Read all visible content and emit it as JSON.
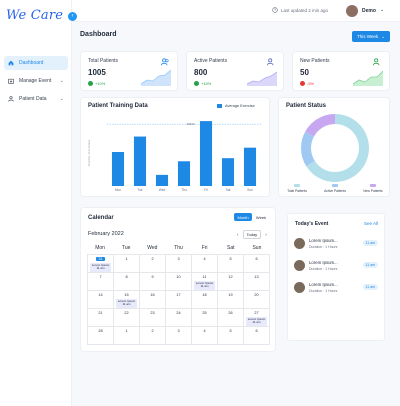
{
  "brand": {
    "name": "We Care"
  },
  "sidebar": {
    "items": [
      {
        "label": "Dashboard",
        "icon": "home-icon",
        "active": true
      },
      {
        "label": "Manage Event",
        "icon": "calendar-plus-icon",
        "active": false
      },
      {
        "label": "Patient Data",
        "icon": "user-icon",
        "active": false
      }
    ]
  },
  "topbar": {
    "last_updated": "Last updated 2 min ago",
    "user_name": "Demo"
  },
  "dashboard": {
    "title": "Dashboard",
    "range_label": "This Week"
  },
  "stats": [
    {
      "label": "Total Patients",
      "value": "1005",
      "change": "+10%",
      "color": "#22a447"
    },
    {
      "label": "Active Patients",
      "value": "800",
      "change": "+15%",
      "color": "#22a447"
    },
    {
      "label": "New Patients",
      "value": "50",
      "change": "-5%",
      "color": "#e53935"
    }
  ],
  "training": {
    "title": "Patient Training Data",
    "legend": "Average Exercise",
    "chart_data": {
      "type": "bar",
      "categories": [
        "Mon",
        "Tue",
        "Wed",
        "Thu",
        "Fri",
        "Sat",
        "Sun"
      ],
      "values": [
        55,
        80,
        18,
        40,
        105,
        45,
        62
      ],
      "ylim": [
        0,
        110
      ],
      "average": 100,
      "average_label": "10000",
      "ylabel": "Number of Activities",
      "color": "#1e88e5"
    }
  },
  "status": {
    "title": "Patient Status",
    "chart_data": {
      "type": "pie",
      "labels": [
        "Total Patients",
        "Active Patients",
        "New Patients"
      ],
      "values": [
        66,
        17,
        17
      ],
      "colors": [
        "#b2dfea",
        "#9fc9f2",
        "#c7a8f0"
      ]
    }
  },
  "calendar": {
    "title": "Calendar",
    "tabs": [
      "Month",
      "Week"
    ],
    "month_label": "February 2022",
    "today_label": "Today",
    "weekdays": [
      "Mon",
      "Tue",
      "Wed",
      "Thu",
      "Fri",
      "Sat",
      "Sun"
    ],
    "weeks": [
      [
        {
          "d": "",
          "sel": false
        },
        {
          "d": "1"
        },
        {
          "d": "2"
        },
        {
          "d": "3"
        },
        {
          "d": "4"
        },
        {
          "d": "5"
        },
        {
          "d": "6"
        }
      ],
      [
        {
          "d": "7"
        },
        {
          "d": "8"
        },
        {
          "d": "9"
        },
        {
          "d": "10"
        },
        {
          "d": "11"
        },
        {
          "d": "12"
        },
        {
          "d": "13"
        }
      ],
      [
        {
          "d": "14"
        },
        {
          "d": "15"
        },
        {
          "d": "16"
        },
        {
          "d": "17"
        },
        {
          "d": "18"
        },
        {
          "d": "19"
        },
        {
          "d": "20"
        }
      ],
      [
        {
          "d": "21"
        },
        {
          "d": "22"
        },
        {
          "d": "23"
        },
        {
          "d": "24"
        },
        {
          "d": "25"
        },
        {
          "d": "26"
        },
        {
          "d": "27"
        }
      ],
      [
        {
          "d": "28"
        },
        {
          "d": "1"
        },
        {
          "d": "2"
        },
        {
          "d": "3"
        },
        {
          "d": "4"
        },
        {
          "d": "5"
        },
        {
          "d": "6"
        }
      ]
    ],
    "selected_label": "31",
    "events": [
      {
        "week": 0,
        "day": 0,
        "title": "Lorem Ipsum",
        "sub": "11 am"
      },
      {
        "week": 1,
        "day": 4,
        "title": "Lorem Ipsum",
        "sub": "11 am"
      },
      {
        "week": 2,
        "day": 1,
        "title": "Lorem Ipsum",
        "sub": "11 am"
      },
      {
        "week": 3,
        "day": 6,
        "title": "Lorem Ipsum",
        "sub": "11 am"
      }
    ]
  },
  "today_events": {
    "title": "Today's Event",
    "see_all": "See All",
    "items": [
      {
        "name": "Lorem Ipsum...",
        "duration": "Duration : 1 Hours",
        "time": "11 am"
      },
      {
        "name": "Lorem Ipsum...",
        "duration": "Duration : 1 Hours",
        "time": "11 am"
      },
      {
        "name": "Lorem Ipsum...",
        "duration": "Duration : 1 Hours",
        "time": "11 am"
      }
    ]
  }
}
